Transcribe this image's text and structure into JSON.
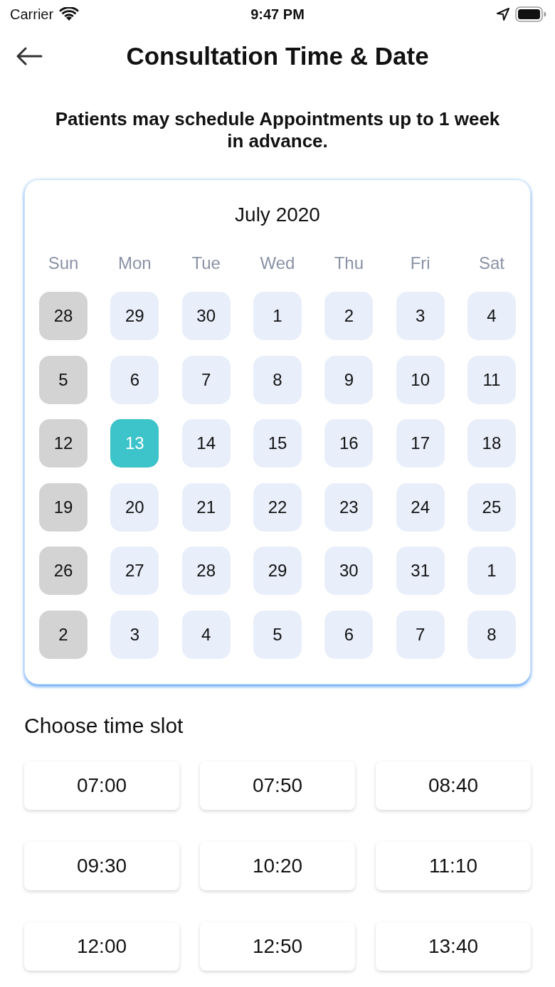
{
  "status_bar": {
    "carrier": "Carrier",
    "time": "9:47 PM"
  },
  "nav": {
    "title": "Consultation Time & Date"
  },
  "notice": "Patients may schedule Appointments up to 1 week in advance.",
  "calendar": {
    "month": "July 2020",
    "weekdays": [
      "Sun",
      "Mon",
      "Tue",
      "Wed",
      "Thu",
      "Fri",
      "Sat"
    ],
    "weeks": [
      [
        {
          "label": "28",
          "disabled": true,
          "selected": false
        },
        {
          "label": "29",
          "disabled": false,
          "selected": false
        },
        {
          "label": "30",
          "disabled": false,
          "selected": false
        },
        {
          "label": "1",
          "disabled": false,
          "selected": false
        },
        {
          "label": "2",
          "disabled": false,
          "selected": false
        },
        {
          "label": "3",
          "disabled": false,
          "selected": false
        },
        {
          "label": "4",
          "disabled": false,
          "selected": false
        }
      ],
      [
        {
          "label": "5",
          "disabled": true,
          "selected": false
        },
        {
          "label": "6",
          "disabled": false,
          "selected": false
        },
        {
          "label": "7",
          "disabled": false,
          "selected": false
        },
        {
          "label": "8",
          "disabled": false,
          "selected": false
        },
        {
          "label": "9",
          "disabled": false,
          "selected": false
        },
        {
          "label": "10",
          "disabled": false,
          "selected": false
        },
        {
          "label": "11",
          "disabled": false,
          "selected": false
        }
      ],
      [
        {
          "label": "12",
          "disabled": true,
          "selected": false
        },
        {
          "label": "13",
          "disabled": false,
          "selected": true
        },
        {
          "label": "14",
          "disabled": false,
          "selected": false
        },
        {
          "label": "15",
          "disabled": false,
          "selected": false
        },
        {
          "label": "16",
          "disabled": false,
          "selected": false
        },
        {
          "label": "17",
          "disabled": false,
          "selected": false
        },
        {
          "label": "18",
          "disabled": false,
          "selected": false
        }
      ],
      [
        {
          "label": "19",
          "disabled": true,
          "selected": false
        },
        {
          "label": "20",
          "disabled": false,
          "selected": false
        },
        {
          "label": "21",
          "disabled": false,
          "selected": false
        },
        {
          "label": "22",
          "disabled": false,
          "selected": false
        },
        {
          "label": "23",
          "disabled": false,
          "selected": false
        },
        {
          "label": "24",
          "disabled": false,
          "selected": false
        },
        {
          "label": "25",
          "disabled": false,
          "selected": false
        }
      ],
      [
        {
          "label": "26",
          "disabled": true,
          "selected": false
        },
        {
          "label": "27",
          "disabled": false,
          "selected": false
        },
        {
          "label": "28",
          "disabled": false,
          "selected": false
        },
        {
          "label": "29",
          "disabled": false,
          "selected": false
        },
        {
          "label": "30",
          "disabled": false,
          "selected": false
        },
        {
          "label": "31",
          "disabled": false,
          "selected": false
        },
        {
          "label": "1",
          "disabled": false,
          "selected": false
        }
      ],
      [
        {
          "label": "2",
          "disabled": true,
          "selected": false
        },
        {
          "label": "3",
          "disabled": false,
          "selected": false
        },
        {
          "label": "4",
          "disabled": false,
          "selected": false
        },
        {
          "label": "5",
          "disabled": false,
          "selected": false
        },
        {
          "label": "6",
          "disabled": false,
          "selected": false
        },
        {
          "label": "7",
          "disabled": false,
          "selected": false
        },
        {
          "label": "8",
          "disabled": false,
          "selected": false
        }
      ]
    ]
  },
  "time_slots": {
    "title": "Choose time slot",
    "slots": [
      {
        "label": "07:00",
        "selected": false
      },
      {
        "label": "07:50",
        "selected": false
      },
      {
        "label": "08:40",
        "selected": false
      },
      {
        "label": "09:30",
        "selected": false
      },
      {
        "label": "10:20",
        "selected": false
      },
      {
        "label": "11:10",
        "selected": false
      },
      {
        "label": "12:00",
        "selected": false
      },
      {
        "label": "12:50",
        "selected": false
      },
      {
        "label": "13:40",
        "selected": false
      }
    ]
  }
}
